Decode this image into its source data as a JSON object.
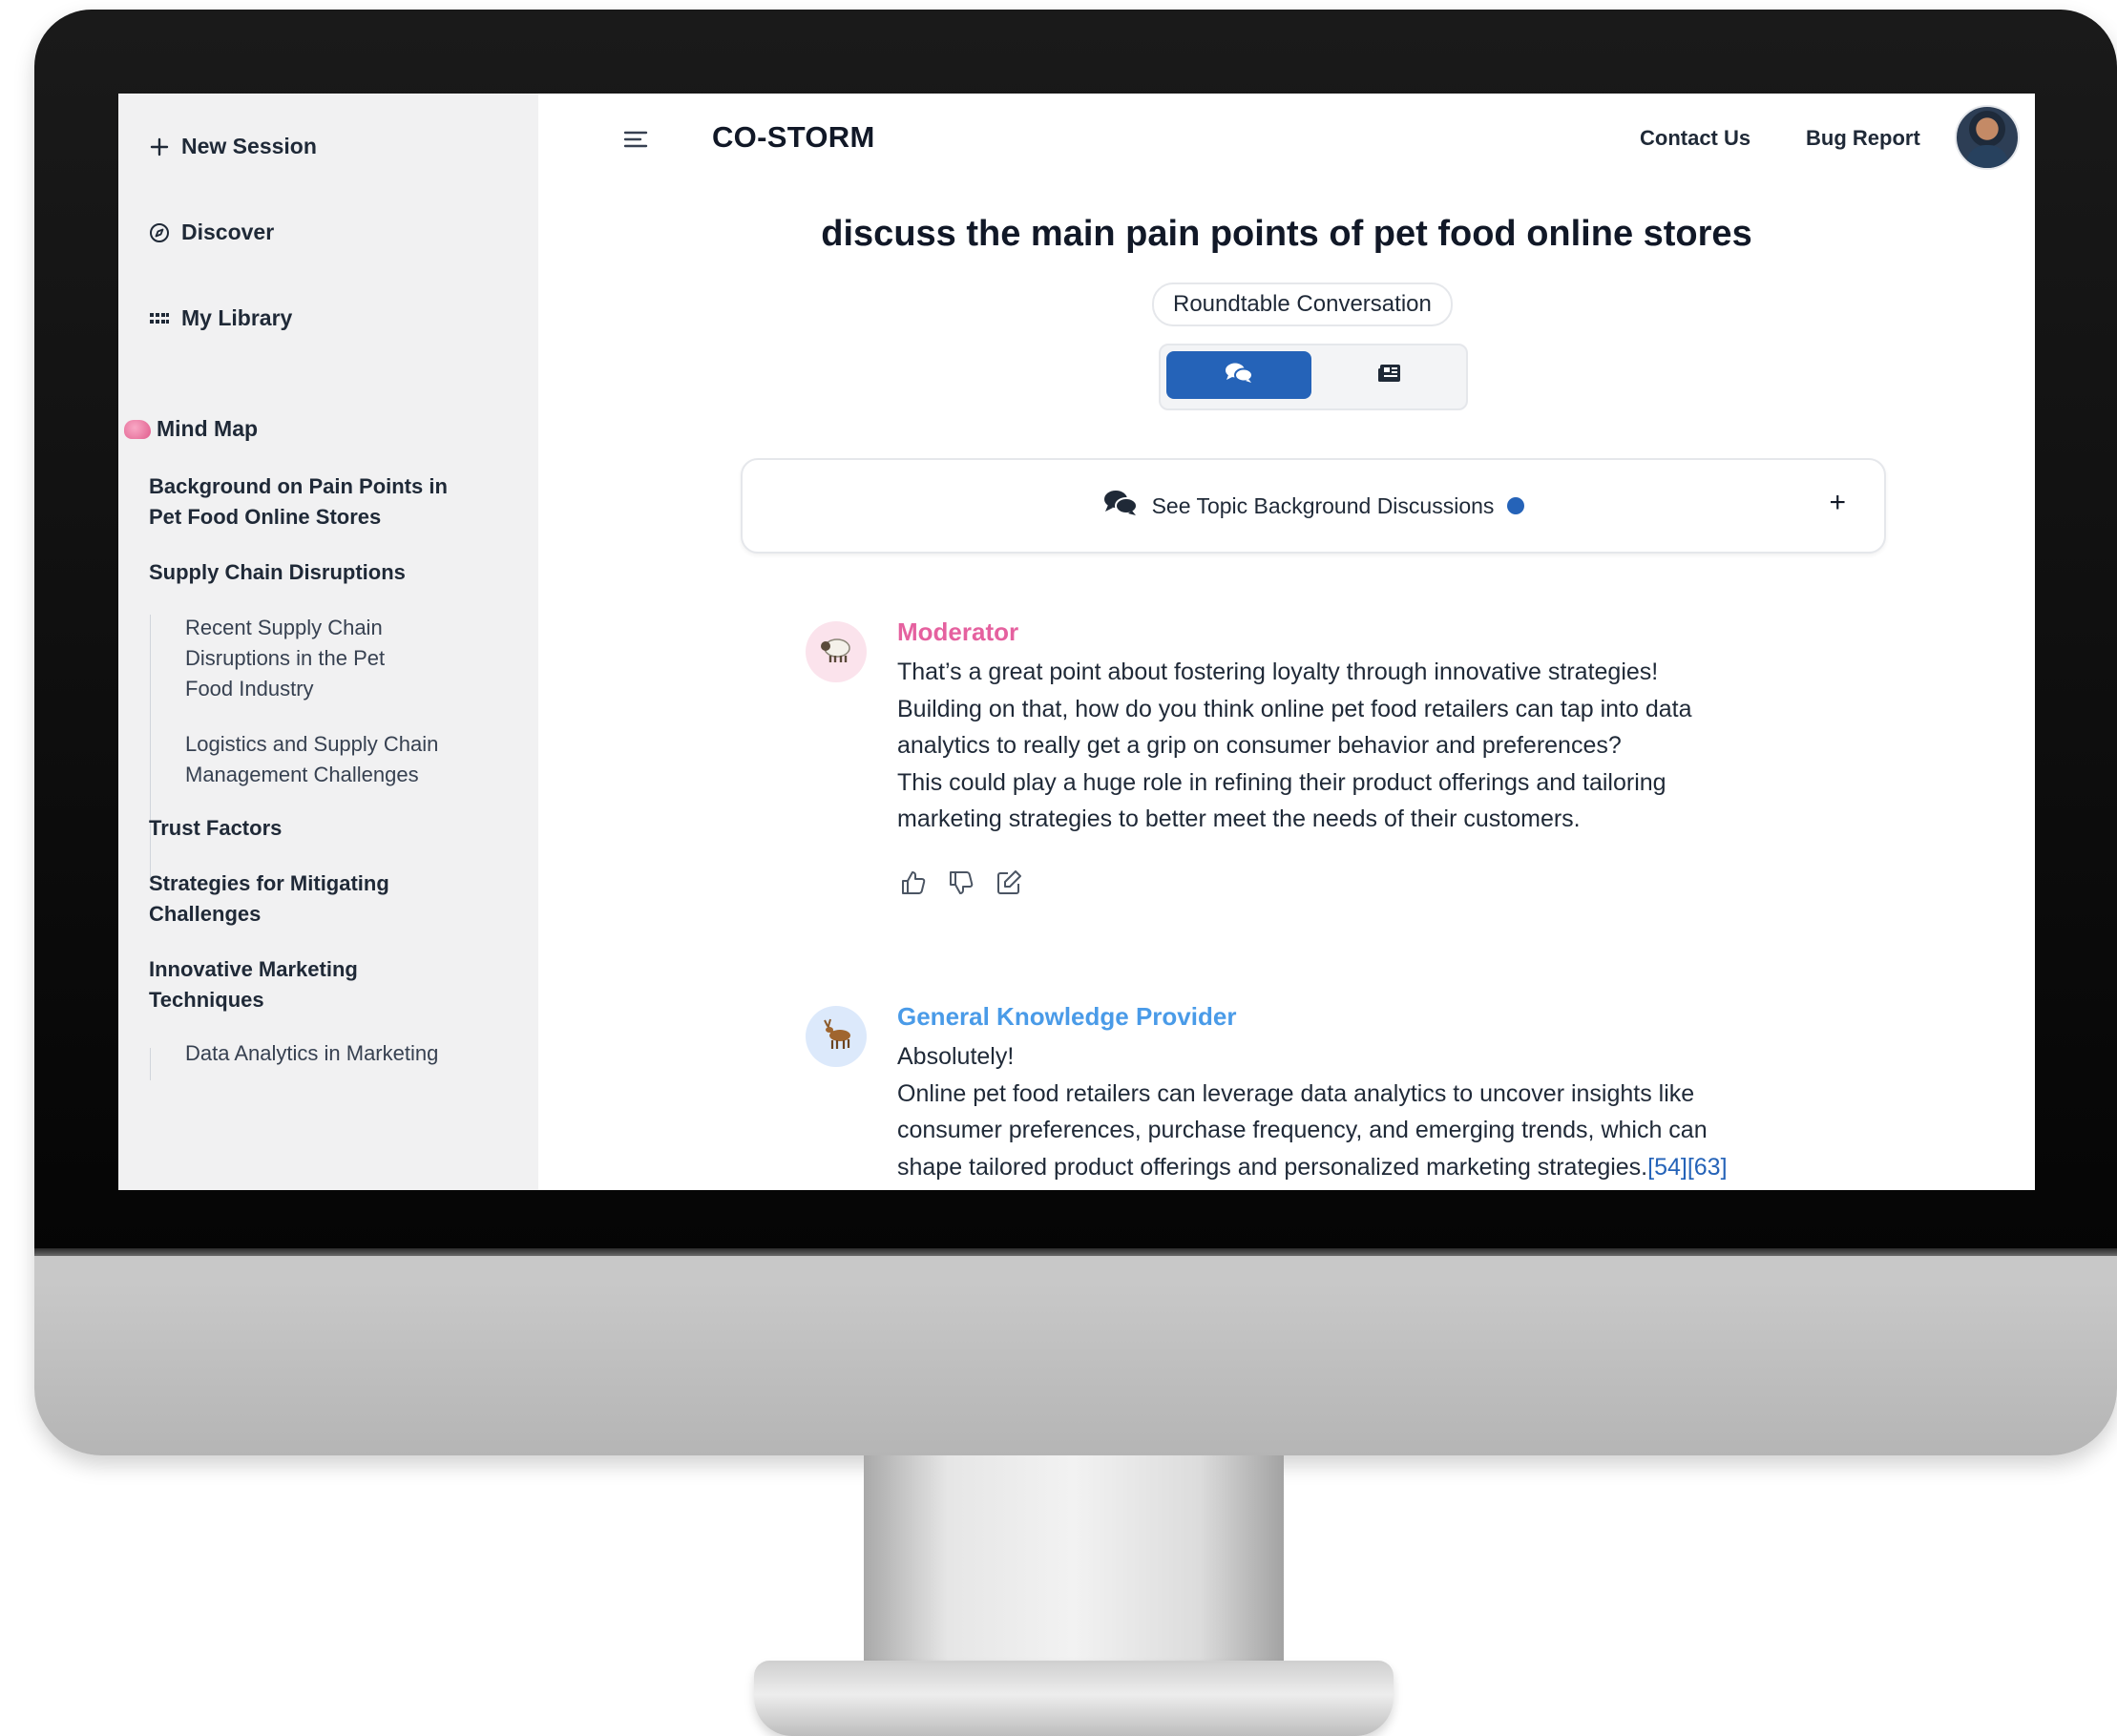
{
  "sidebar": {
    "new_session": "New Session",
    "discover": "Discover",
    "my_library": "My Library",
    "mind_map_heading": "Mind Map",
    "mind_map": [
      {
        "label": "Background on Pain Points in Pet Food Online Stores",
        "level": 1
      },
      {
        "label": "Supply Chain Disruptions",
        "level": 1
      },
      {
        "label": "Recent Supply Chain Disruptions in the Pet Food Industry",
        "level": 2
      },
      {
        "label": "Logistics and Supply Chain Management Challenges",
        "level": 2
      },
      {
        "label": "Trust Factors",
        "level": 1
      },
      {
        "label": "Strategies for Mitigating Challenges",
        "level": 1
      },
      {
        "label": "Innovative Marketing Techniques",
        "level": 1
      },
      {
        "label": "Data Analytics in Marketing",
        "level": 2
      }
    ]
  },
  "header": {
    "brand": "CO-STORM",
    "contact_us": "Contact Us",
    "bug_report": "Bug Report"
  },
  "main": {
    "topic_title": "discuss the main pain points of pet food online stores",
    "mode_badge": "Roundtable Conversation",
    "background_panel_label": "See Topic Background Discussions",
    "background_panel_toggle": "+",
    "messages": [
      {
        "speaker": "Moderator",
        "speaker_color": "#e5619f",
        "avatar_icon": "sheep-icon",
        "lines": [
          "That’s a great point about fostering loyalty through innovative strategies!",
          "Building on that, how do you think online pet food retailers can tap into data",
          "analytics to really get a grip on consumer behavior and preferences?",
          "This could play a huge role in refining their product offerings and tailoring",
          "marketing strategies to better meet the needs of their customers."
        ]
      },
      {
        "speaker": "General Knowledge Provider",
        "speaker_color": "#4a9be8",
        "avatar_icon": "deer-icon",
        "lines": [
          "Absolutely!",
          "Online pet food retailers can leverage data analytics to uncover insights like",
          "consumer preferences, purchase frequency, and emerging trends, which can",
          "shape tailored product offerings and personalized marketing strategies."
        ],
        "citations": [
          "[54]",
          "[63]"
        ]
      }
    ]
  },
  "colors": {
    "accent": "#2563b8",
    "sidebar_bg": "#f1f1f2"
  }
}
